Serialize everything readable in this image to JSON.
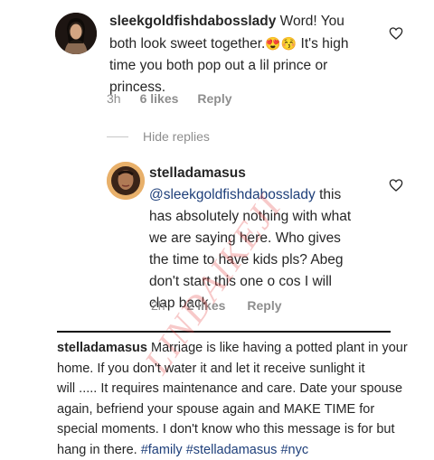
{
  "comment": {
    "username": "sleekgoldfishdabosslady",
    "text_line1": "Word! You",
    "text_line2": "both look sweet together.",
    "emojis": "😍😚",
    "text_line2_after": "It's high",
    "text_line3": "time you both pop out a lil prince or",
    "text_line4": "princess.",
    "time": "3h",
    "likes": "6 likes",
    "reply": "Reply"
  },
  "hide_replies": "Hide replies",
  "reply_comment": {
    "username": "stelladamasus",
    "mention": "@sleekgoldfishdabosslady",
    "text_line1_after": "this",
    "text_line2": "has absolutely nothing with what",
    "text_line3": "we are saying here. Who gives",
    "text_line4": "the time to have kids pls? Abeg",
    "text_line5": "don't start this one o cos I will",
    "text_line6": "clap back",
    "time": "2h",
    "likes": "2 likes",
    "reply": "Reply"
  },
  "post": {
    "username": "stelladamasus",
    "line1_after": "Marriage is like having a potted plant in your",
    "line2": "home. If you don't water it and let it receive sunlight it",
    "line3": "will ..... It requires maintenance and care. Date your spouse",
    "line4": "again, befriend your spouse again and MAKE TIME for",
    "line5": "special moments. I don't know who this message is for but",
    "line6_pre": "hang in there.",
    "tags": [
      "#family",
      "#stelladamasus",
      "#nyc"
    ]
  },
  "watermark": "LINDAIKEJI",
  "colors": {
    "link": "#1e3f7a",
    "meta": "#8e8e8e",
    "text": "#262626"
  },
  "icons": {
    "heart": "heart-outline-icon"
  }
}
